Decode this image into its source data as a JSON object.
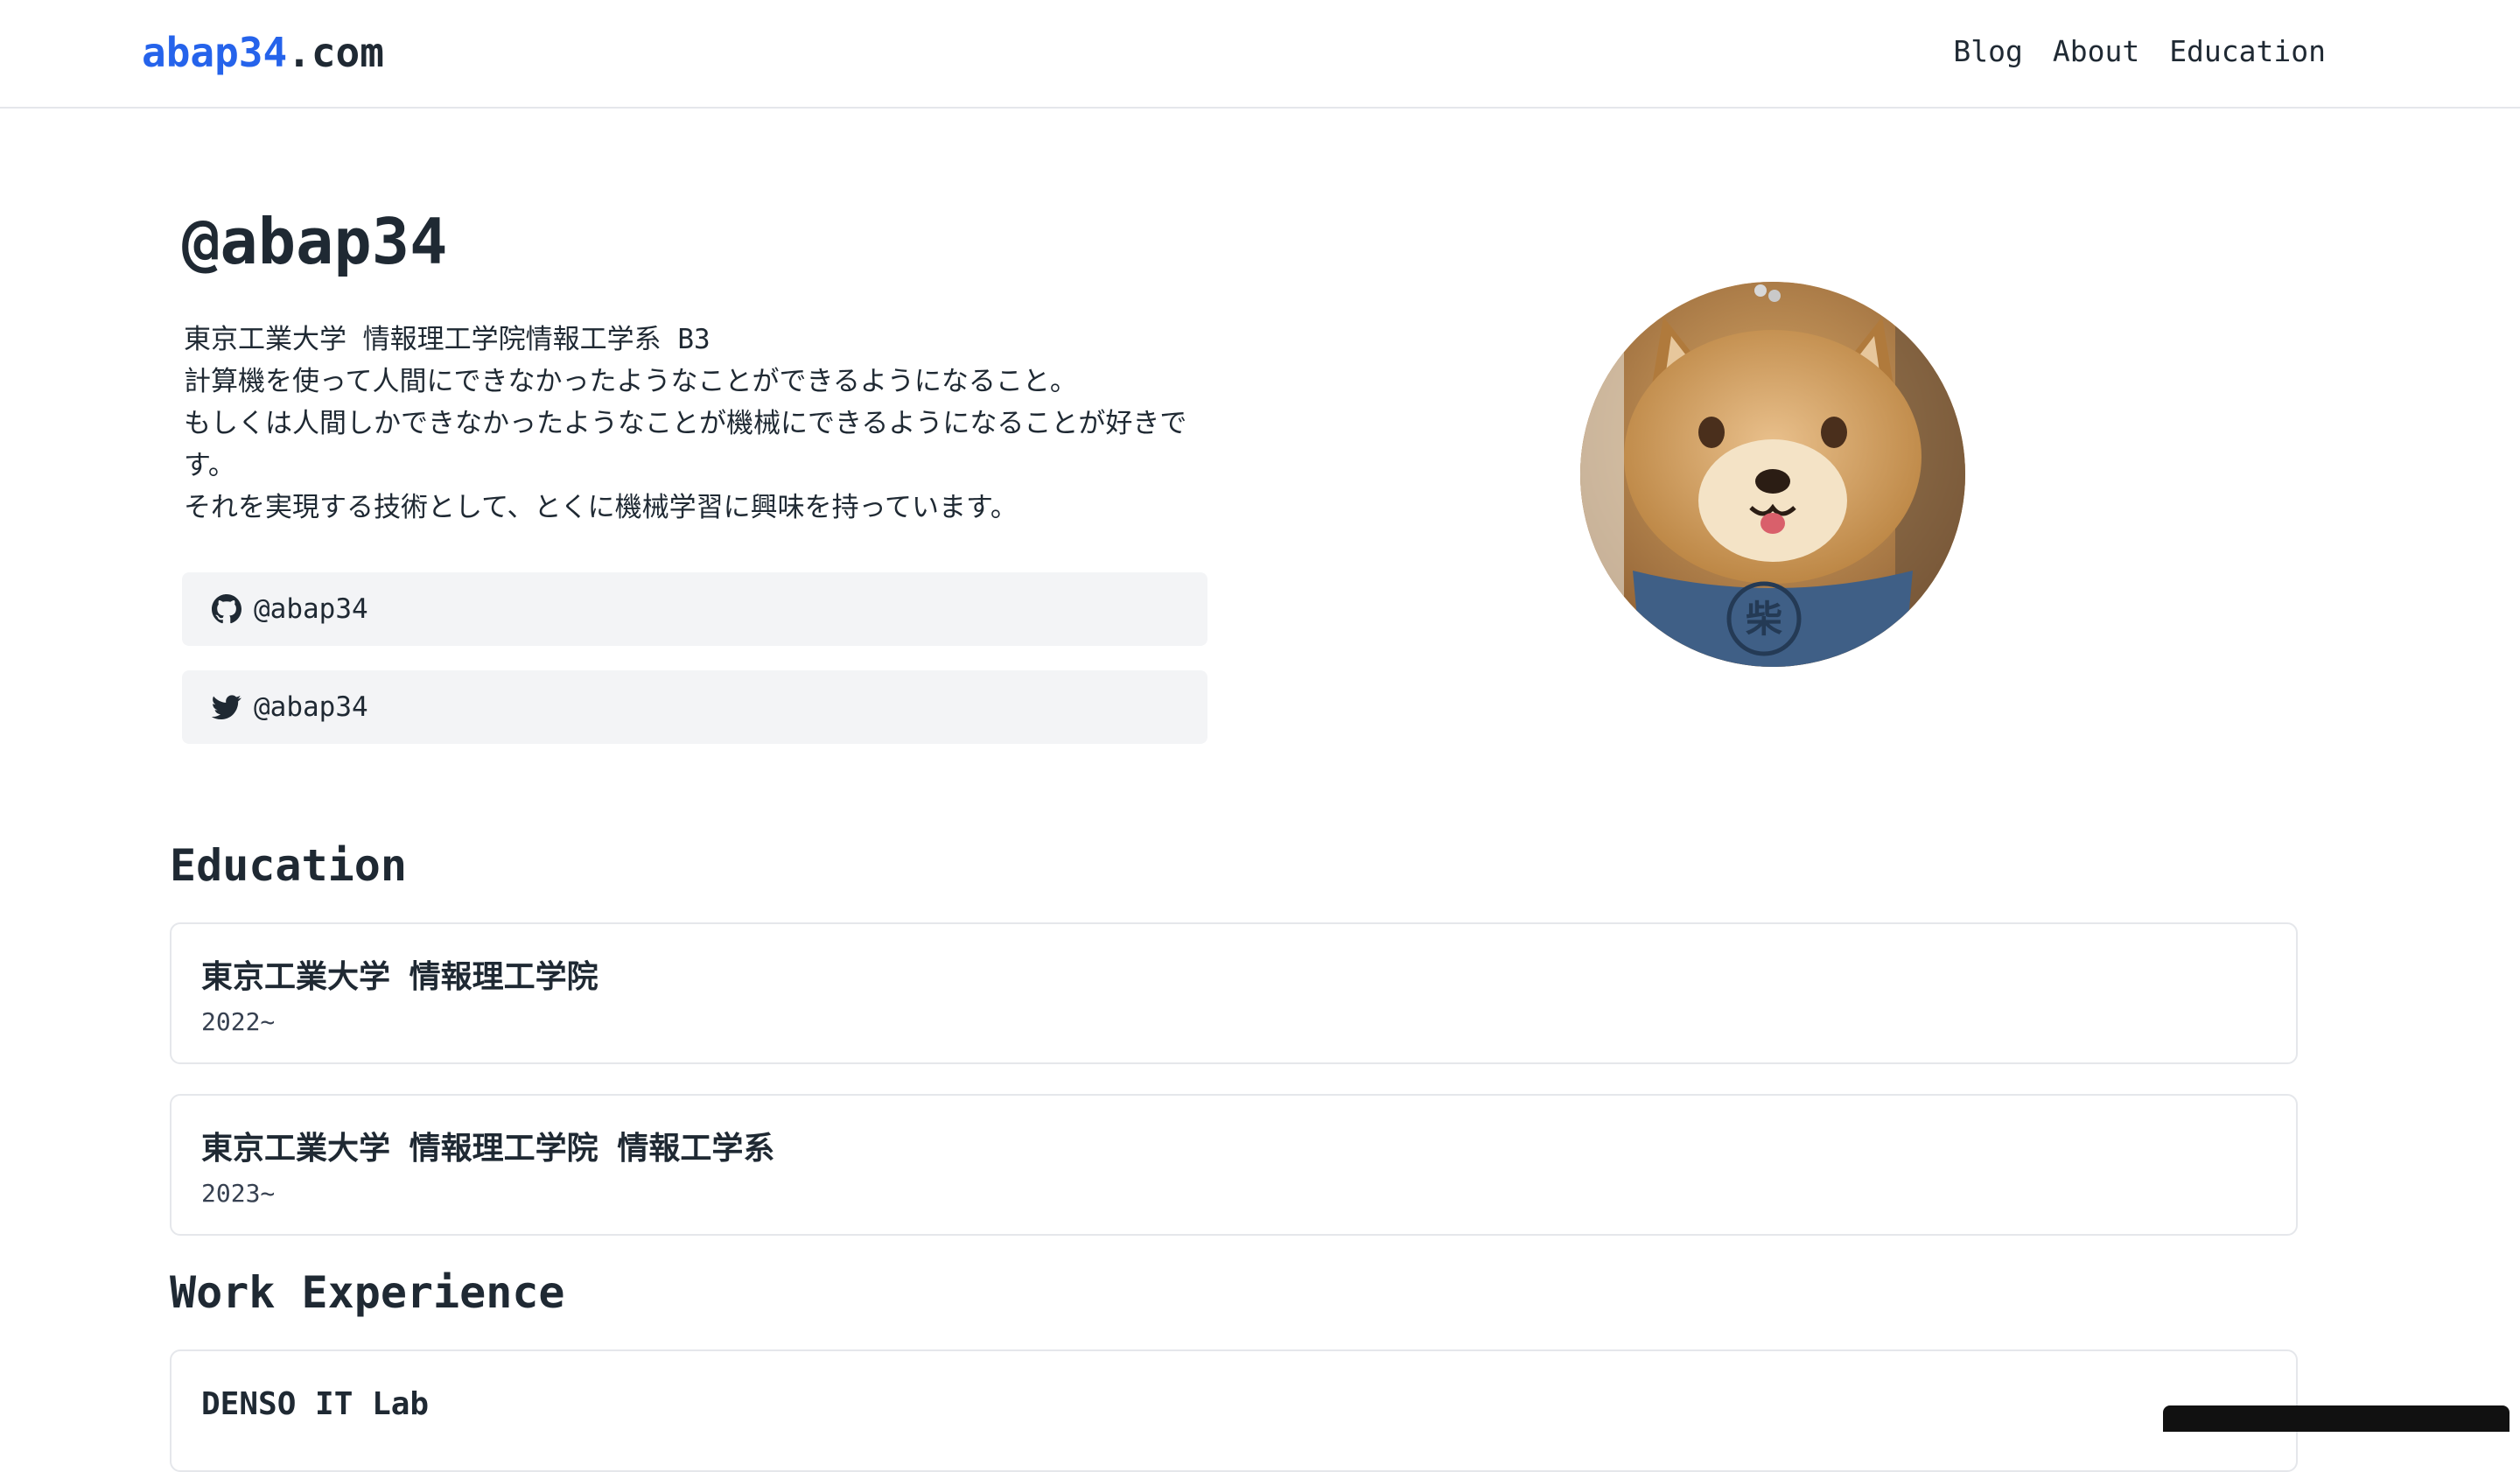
{
  "header": {
    "logo_main": "abap34",
    "logo_tld": ".com",
    "nav": [
      {
        "label": "Blog"
      },
      {
        "label": "About"
      },
      {
        "label": "Education"
      }
    ]
  },
  "profile": {
    "handle": "@abap34",
    "bio": [
      "東京工業大学 情報理工学院情報工学系 B3",
      "計算機を使って人間にできなかったようなことができるようになること。",
      "もしくは人間しかできなかったようなことが機械にできるようになることが好きです。",
      "それを実現する技術として、とくに機械学習に興味を持っています。"
    ],
    "github": {
      "label": "@abap34",
      "icon": "github-icon"
    },
    "twitter": {
      "label": "@abap34",
      "icon": "twitter-icon"
    },
    "avatar": {
      "icon": "shiba-plush-avatar",
      "badge_text": "柴"
    }
  },
  "education": {
    "title": "Education",
    "items": [
      {
        "name": "東京工業大学 情報理工学院",
        "period": "2022~"
      },
      {
        "name": "東京工業大学 情報理工学院 情報工学系",
        "period": "2023~"
      }
    ]
  },
  "work": {
    "title": "Work Experience",
    "items": [
      {
        "name": "DENSO IT Lab"
      }
    ]
  },
  "colors": {
    "accent": "#2563eb",
    "text": "#1f2933",
    "card_border": "#e5e7eb",
    "social_bg": "#f3f4f6"
  }
}
